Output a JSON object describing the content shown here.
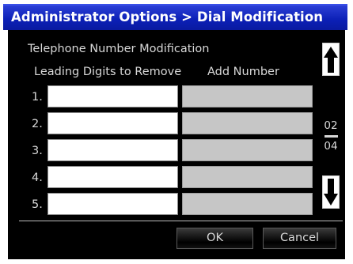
{
  "window": {
    "title": "Administrator Options > Dial Modification"
  },
  "section": {
    "title": "Telephone Number Modification"
  },
  "columns": {
    "digits_to_remove": "Leading Digits to Remove",
    "add_number": "Add Number"
  },
  "rows": [
    {
      "number": "1.",
      "digits_to_remove": "",
      "add_number": ""
    },
    {
      "number": "2.",
      "digits_to_remove": "",
      "add_number": ""
    },
    {
      "number": "3.",
      "digits_to_remove": "",
      "add_number": ""
    },
    {
      "number": "4.",
      "digits_to_remove": "",
      "add_number": ""
    },
    {
      "number": "5.",
      "digits_to_remove": "",
      "add_number": ""
    }
  ],
  "pagination": {
    "current": "02",
    "total": "04"
  },
  "buttons": {
    "ok": "OK",
    "cancel": "Cancel"
  },
  "icons": {
    "scroll_up": "arrow-up-icon",
    "scroll_down": "arrow-down-icon"
  },
  "colors": {
    "title_bar": "#0b1fb5",
    "panel": "#000000",
    "add_number_field": "#c6c6c6"
  }
}
